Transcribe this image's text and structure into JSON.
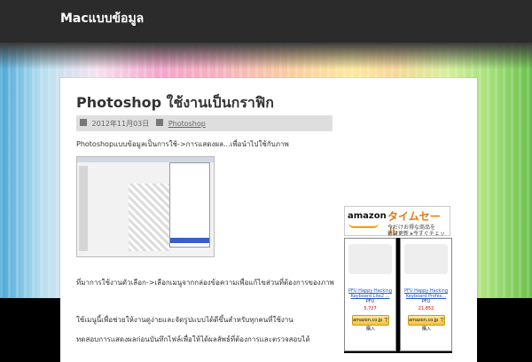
{
  "site": {
    "title": "Macแบบข้อมูล"
  },
  "post": {
    "title": "Photoshop ใช้งานเป็นกราฟิก",
    "date": "2012年11月03日",
    "category": "Photoshop",
    "p1": "Photoshopแบบข้อมูลเป็นการใช้->การแสดงผล...เพื่อนำไปใช้กับภาพ",
    "p2": "ที่มาการใช้งานตัวเลือก->เลือกเมนูจากกล่องข้อความเพื่อแก้ไขส่วนที่ต้องการของภาพ",
    "p3": "ใช้เมนูนี้เพื่อช่วยให้งานดูง่ายและจัดรูปแบบได้ดีขึ้นสำหรับทุกคนที่ใช้งาน",
    "p4": "ทดสอบการแสดงผลก่อนบันทึกไฟล์เพื่อให้ได้ผลลัพธ์ที่ต้องการและตรวจสอบได้"
  },
  "sidebar": {
    "banner": {
      "logo": "amazon",
      "headline": "タイムセール",
      "line1": "今だけお得な商品を",
      "line2": "毎日更新  ▸今すぐチェック"
    },
    "products": [
      {
        "name": "PFU Happy Hacking Keyboard Lite2 ...",
        "maker": "PFU",
        "price": "5,727",
        "button": "amazon.co.jp で購入",
        "style": "light"
      },
      {
        "name": "PFU Happy Hacking Keyboard Profes...",
        "maker": "PFU",
        "price": "21,852",
        "button": "amazon.co.jp で購入",
        "style": "dark"
      }
    ]
  }
}
